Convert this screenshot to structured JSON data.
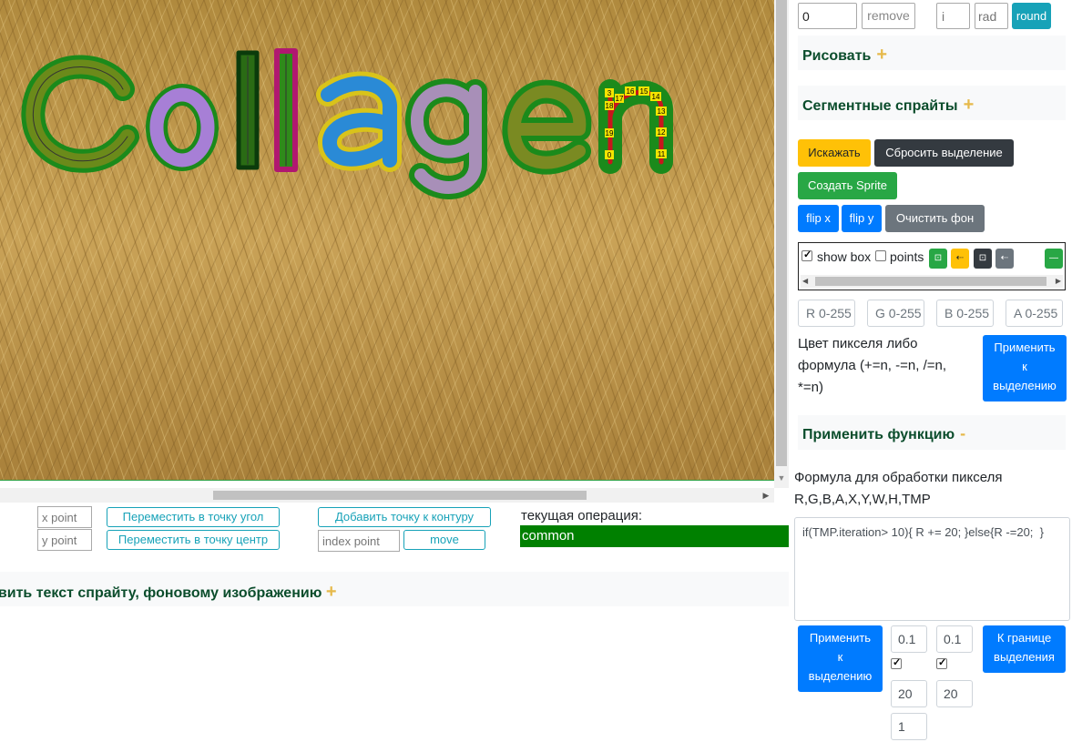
{
  "canvas": {
    "word": "Collagen",
    "contour_point_labels_left": [
      "3",
      "17",
      "18",
      "19",
      "0"
    ],
    "contour_point_labels_top": [
      "16",
      "15",
      "14"
    ],
    "contour_point_labels_right": [
      "13",
      "12",
      "11"
    ]
  },
  "point_controls": {
    "x_placeholder": "x point",
    "y_placeholder": "y point",
    "move_corner_label": "Переместить в точку угол",
    "move_center_label": "Переместить в точку центр",
    "add_point_label": "Добавить точку к контуру",
    "index_placeholder": "index point",
    "move_label": "move"
  },
  "current_operation": {
    "label": "текущая операция:",
    "value": "common"
  },
  "text_section": {
    "title": "авить текст спрайту, фоновому изображению"
  },
  "right_panel": {
    "top_row": {
      "value_input": "0",
      "remove_label": "remove",
      "i_placeholder": "i",
      "rad_placeholder": "rad",
      "round_label": "round"
    },
    "draw_section": "Рисовать",
    "segment_section": "Сегментные спрайты",
    "buttons": {
      "distort": "Искажать",
      "reset_selection": "Сбросить выделение",
      "create_sprite": "Создать Sprite",
      "flip_x": "flip x",
      "flip_y": "flip y",
      "clear_bg": "Очистить фон"
    },
    "toolbox": {
      "show_box_label": "show box",
      "show_box_checked": true,
      "points_label": "points",
      "points_checked": false
    },
    "rgba_placeholders": [
      "R 0-255",
      "G 0-255",
      "B 0-255",
      "A 0-255"
    ],
    "color_text": "Цвет пикселя либо формула (+=n, -=n, /=n, *=n)",
    "apply_selection_1": [
      "Применить",
      "к",
      "выделению"
    ],
    "apply_function_section": "Применить функцию",
    "formula_label": "Формула для обработки пикселя R,G,B,A,X,Y,W,H,TMP",
    "formula_value": "if(TMP.iteration> 10){ R += 20; }else{R -=20;  }",
    "apply_selection_2": [
      "Применить",
      "к",
      "выделению"
    ],
    "param_1": "0.1",
    "param_2": "0.1",
    "param_3": "20",
    "param_4": "20",
    "param_5": "1",
    "to_border": [
      "К границе",
      "выделения"
    ]
  },
  "colors": {
    "accent_green": "#008000",
    "section_title": "#0b4d2c",
    "plus": "#e6b94a",
    "primary": "#007bff",
    "warning": "#ffc107",
    "dark": "#343a40",
    "success": "#28a745",
    "info": "#17a2b8"
  }
}
